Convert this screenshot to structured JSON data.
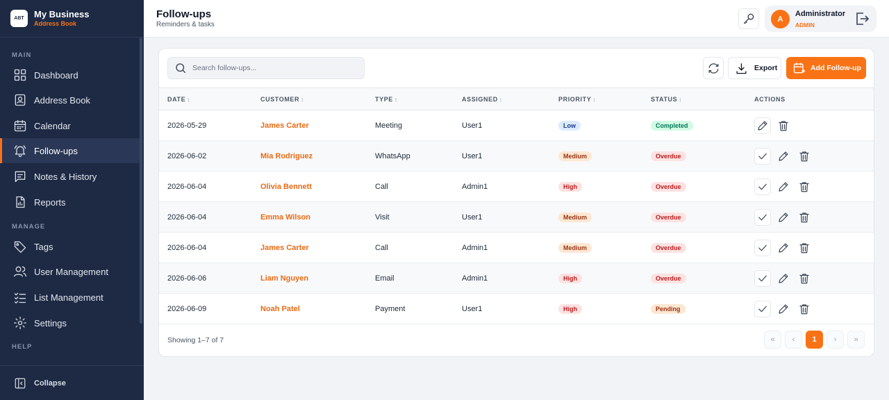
{
  "brand": {
    "logo_text": "ABT",
    "name": "My Business",
    "sub": "Address Book"
  },
  "sidebar": {
    "sections": {
      "main": "MAIN",
      "manage": "MANAGE",
      "help": "HELP"
    },
    "items": [
      {
        "label": "Dashboard",
        "icon": "grid-icon"
      },
      {
        "label": "Address Book",
        "icon": "contact-book-icon"
      },
      {
        "label": "Calendar",
        "icon": "calendar-icon"
      },
      {
        "label": "Follow-ups",
        "icon": "bell-icon",
        "active": true
      },
      {
        "label": "Notes & History",
        "icon": "notes-icon"
      },
      {
        "label": "Reports",
        "icon": "report-icon"
      },
      {
        "label": "Tags",
        "icon": "tag-icon"
      },
      {
        "label": "User Management",
        "icon": "users-icon"
      },
      {
        "label": "List Management",
        "icon": "checklist-icon"
      },
      {
        "label": "Settings",
        "icon": "gear-icon"
      }
    ],
    "collapse_label": "Collapse"
  },
  "header": {
    "title": "Follow-ups",
    "subtitle": "Reminders & tasks"
  },
  "user": {
    "initial": "A",
    "name": "Administrator",
    "role": "ADMIN"
  },
  "toolbar": {
    "search_placeholder": "Search follow-ups...",
    "export_label": "Export",
    "add_label": "Add Follow-up"
  },
  "table": {
    "columns": [
      "DATE",
      "CUSTOMER",
      "TYPE",
      "ASSIGNED",
      "PRIORITY",
      "STATUS",
      "ACTIONS"
    ],
    "rows": [
      {
        "date": "2026-05-29",
        "customer": "James Carter",
        "type": "Meeting",
        "assigned": "User1",
        "priority": "Low",
        "status": "Completed"
      },
      {
        "date": "2026-06-02",
        "customer": "Mia Rodriguez",
        "type": "WhatsApp",
        "assigned": "User1",
        "priority": "Medium",
        "status": "Overdue"
      },
      {
        "date": "2026-06-04",
        "customer": "Olivia Bennett",
        "type": "Call",
        "assigned": "Admin1",
        "priority": "High",
        "status": "Overdue"
      },
      {
        "date": "2026-06-04",
        "customer": "Emma Wilson",
        "type": "Visit",
        "assigned": "User1",
        "priority": "Medium",
        "status": "Overdue"
      },
      {
        "date": "2026-06-04",
        "customer": "James Carter",
        "type": "Call",
        "assigned": "Admin1",
        "priority": "Medium",
        "status": "Overdue"
      },
      {
        "date": "2026-06-06",
        "customer": "Liam Nguyen",
        "type": "Email",
        "assigned": "Admin1",
        "priority": "High",
        "status": "Overdue"
      },
      {
        "date": "2026-06-09",
        "customer": "Noah Patel",
        "type": "Payment",
        "assigned": "User1",
        "priority": "High",
        "status": "Pending"
      }
    ]
  },
  "footer": {
    "showing": "Showing 1–7 of 7"
  },
  "pagination": {
    "first": "«",
    "prev": "‹",
    "current": "1",
    "next": "›",
    "last": "»"
  },
  "colors": {
    "sidebar": "#1e2a44",
    "accent": "#f97316"
  }
}
